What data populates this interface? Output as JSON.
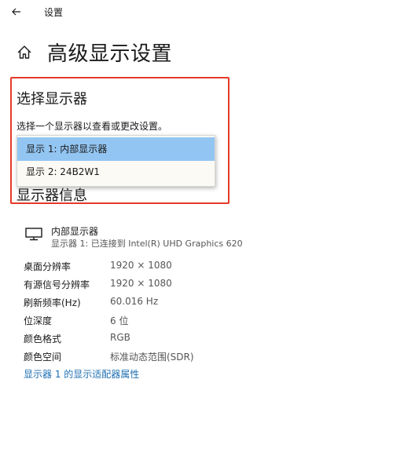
{
  "window": {
    "title": "设置"
  },
  "header": {
    "title": "高级显示设置"
  },
  "select_display": {
    "heading": "选择显示器",
    "description": "选择一个显示器以查看或更改设置。",
    "options": [
      "显示 1: 内部显示器",
      "显示 2: 24B2W1"
    ],
    "selected_index": 0
  },
  "display_info": {
    "heading": "显示器信息",
    "monitor_name": "内部显示器",
    "connection": "显示器 1: 已连接到 Intel(R) UHD Graphics 620",
    "rows": [
      {
        "label": "桌面分辨率",
        "value": "1920 × 1080"
      },
      {
        "label": "有源信号分辨率",
        "value": "1920 × 1080"
      },
      {
        "label": "刷新频率(Hz)",
        "value": "60.016 Hz"
      },
      {
        "label": "位深度",
        "value": "6 位"
      },
      {
        "label": "颜色格式",
        "value": "RGB"
      },
      {
        "label": "颜色空间",
        "value": "标准动态范围(SDR)"
      }
    ],
    "adapter_link": "显示器 1 的显示适配器属性"
  },
  "colors": {
    "highlight_border": "#e43a2a",
    "selected_option": "#93c5f2",
    "link": "#1f6fb2"
  },
  "icons": {
    "back": "back-arrow-icon",
    "home": "home-icon",
    "monitor": "monitor-icon"
  }
}
